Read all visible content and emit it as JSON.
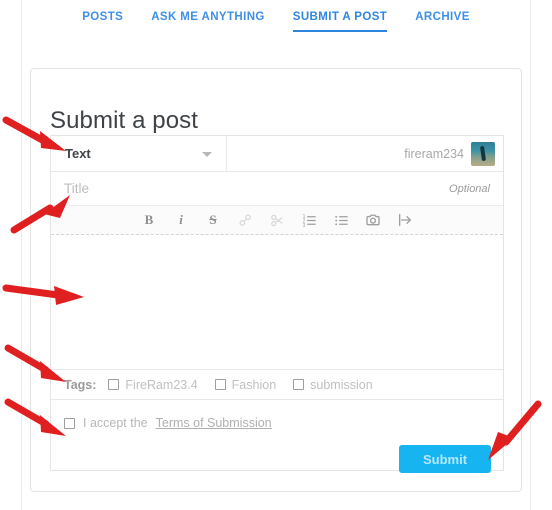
{
  "nav": {
    "tabs": [
      {
        "label": "POSTS",
        "active": false
      },
      {
        "label": "ASK ME ANYTHING",
        "active": false
      },
      {
        "label": "SUBMIT A POST",
        "active": true
      },
      {
        "label": "ARCHIVE",
        "active": false
      }
    ],
    "link_color": "#3d8fe8",
    "active_color": "#2f86e0"
  },
  "card": {
    "title": "Submit a post"
  },
  "form": {
    "post_type": {
      "selected": "Text",
      "caret_icon": "chevron-down-icon"
    },
    "user": {
      "name": "fireram234",
      "avatar_icon": "user-avatar-photo"
    },
    "title_field": {
      "value": "",
      "placeholder": "Title",
      "optional_label": "Optional"
    },
    "toolbar": {
      "buttons": [
        {
          "name": "bold",
          "glyph": "B",
          "enabled": true
        },
        {
          "name": "italic",
          "glyph": "i",
          "enabled": true
        },
        {
          "name": "strikethrough",
          "glyph": "S",
          "enabled": true
        },
        {
          "name": "link",
          "glyph": "link-icon",
          "enabled": false
        },
        {
          "name": "unlink",
          "glyph": "unlink-icon",
          "enabled": false
        },
        {
          "name": "ordered-list",
          "glyph": "ordered-list-icon",
          "enabled": true
        },
        {
          "name": "unordered-list",
          "glyph": "unordered-list-icon",
          "enabled": true
        },
        {
          "name": "insert-image",
          "glyph": "camera-icon",
          "enabled": true
        },
        {
          "name": "read-more",
          "glyph": "read-more-icon",
          "enabled": true
        }
      ]
    },
    "editor": {
      "body_text": ""
    },
    "tags": {
      "label": "Tags:",
      "items": [
        {
          "label": "FireRam23.4",
          "checked": false
        },
        {
          "label": "Fashion",
          "checked": false
        },
        {
          "label": "submission",
          "checked": false
        }
      ]
    },
    "accept": {
      "checked": false,
      "text": "I accept the",
      "link_label": "Terms of Submission"
    },
    "submit": {
      "label": "Submit",
      "color": "#17b4f2",
      "text_color": "#b6e8fb"
    }
  },
  "annotations": {
    "arrow_color": "#e02020",
    "arrows": [
      {
        "name": "arrow-to-type-select",
        "points_to": "post type dropdown"
      },
      {
        "name": "arrow-to-title-field",
        "points_to": "title input"
      },
      {
        "name": "arrow-to-editor-body",
        "points_to": "editor body"
      },
      {
        "name": "arrow-to-tags-row",
        "points_to": "tags row"
      },
      {
        "name": "arrow-to-accept-checkbox",
        "points_to": "accept terms checkbox"
      },
      {
        "name": "arrow-to-submit-button",
        "points_to": "submit button"
      }
    ]
  }
}
